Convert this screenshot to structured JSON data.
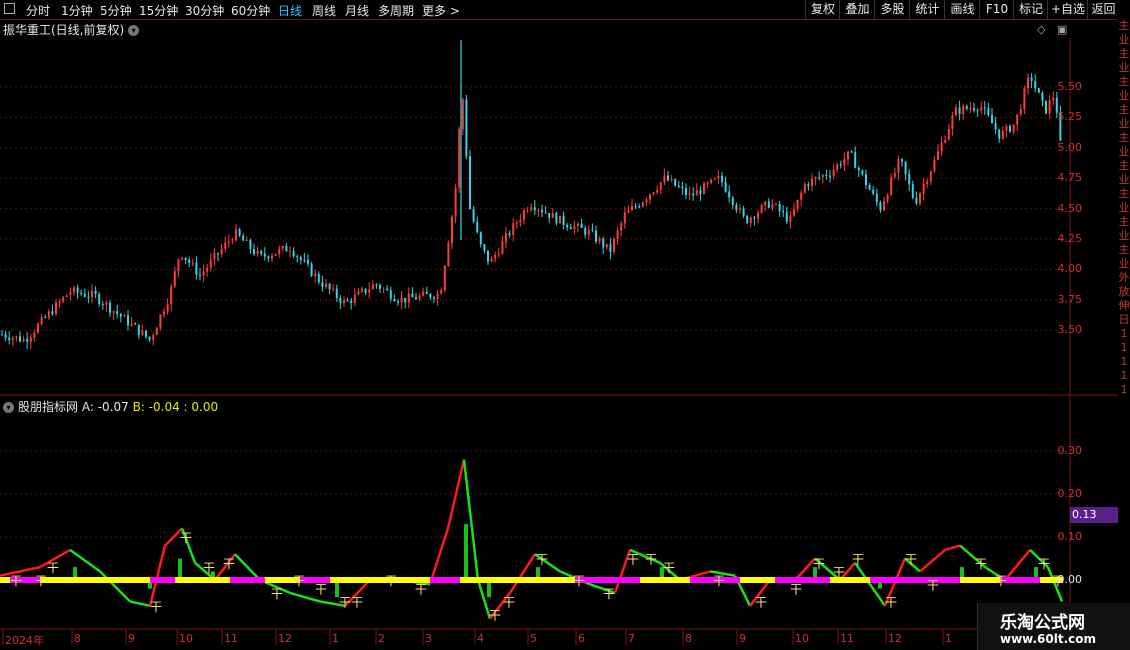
{
  "toolbar": {
    "periods": [
      "分时",
      "1分钟",
      "5分钟",
      "15分钟",
      "30分钟",
      "60分钟",
      "日线",
      "周线",
      "月线",
      "多周期",
      "更多 >"
    ],
    "active_period": "日线",
    "right_buttons": [
      "复权",
      "叠加",
      "多股",
      "统计",
      "画线",
      "F10",
      "标记",
      "+自选",
      "返回"
    ]
  },
  "stock": {
    "title": "振华重工(日线,前复权)",
    "price_axis": [
      "5.50",
      "5.25",
      "5.00",
      "4.75",
      "4.50",
      "4.25",
      "4.00",
      "3.75",
      "3.50"
    ]
  },
  "indicator": {
    "name": "股朋指标网",
    "a_text": "A: -0.07",
    "b_text": "B: -0.04 : 0.00",
    "axis": [
      "0.30",
      "0.20",
      "0.10",
      "0.00"
    ],
    "current_marker": "0.13",
    "signal_mark": "干"
  },
  "side_strip": [
    "主",
    "业",
    "主",
    "业",
    "主",
    "业",
    "主",
    "业",
    "主",
    "业",
    "主",
    "业",
    "主",
    "业",
    "主",
    "业",
    "主",
    "业",
    "外",
    "放",
    "伸",
    "日",
    "1",
    "1",
    "1",
    "1",
    "1"
  ],
  "dates": [
    "2024年",
    "8",
    "9",
    "10",
    "11",
    "12",
    "1",
    "2",
    "3",
    "4",
    "5",
    "6",
    "7",
    "8",
    "9",
    "10",
    "11",
    "12",
    "1"
  ],
  "watermark": {
    "line1": "乐淘公式网",
    "line2": "www.60lt.com"
  },
  "colors": {
    "up": "#ff3b3b",
    "down": "#31d7e8",
    "line_up": "#ff1a1a",
    "line_down": "#19e019",
    "base_yellow": "#ffff00",
    "base_magenta": "#ff00ff",
    "grid": "#5a1010"
  }
}
